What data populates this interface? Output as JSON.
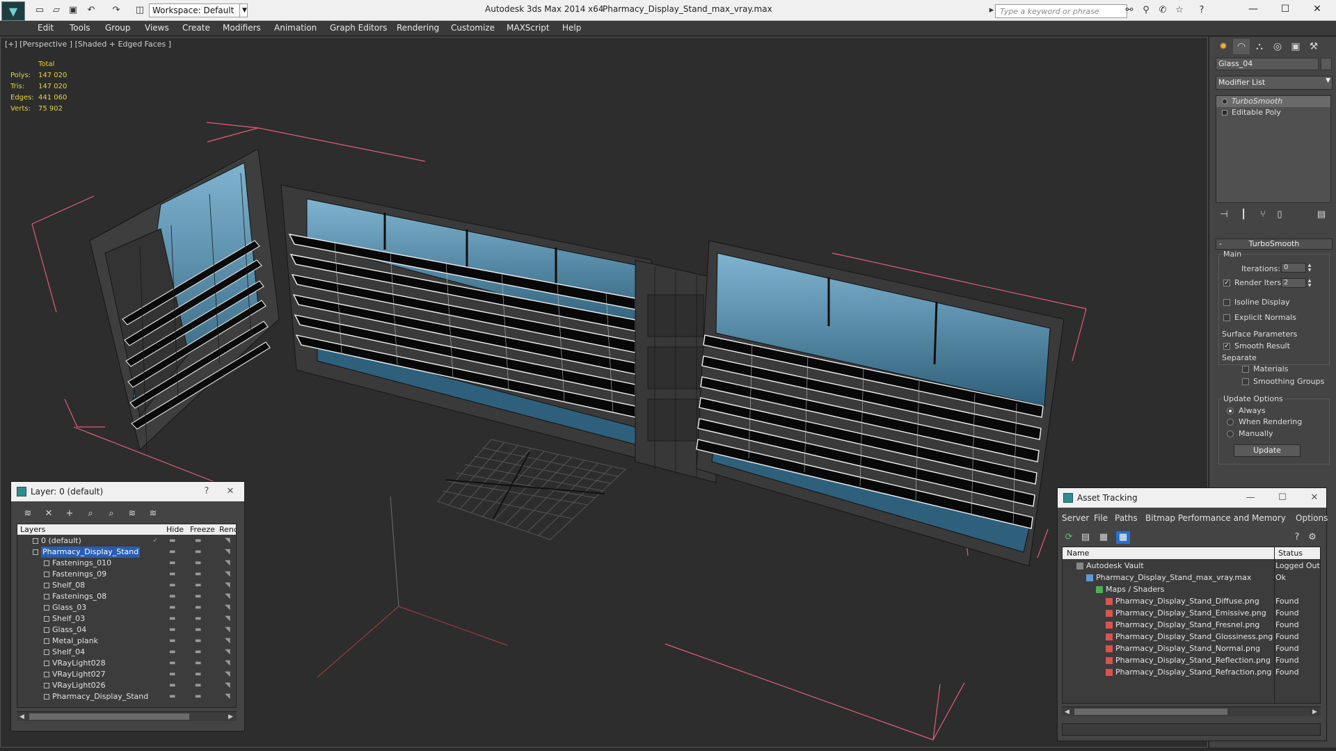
{
  "titlebar": {
    "workspace": "Workspace: Default",
    "app_title": "Autodesk 3ds Max  2014 x64",
    "file_title": "Pharmacy_Display_Stand_max_vray.max",
    "search_placeholder": "Type a keyword or phrase"
  },
  "menu": [
    "Edit",
    "Tools",
    "Group",
    "Views",
    "Create",
    "Modifiers",
    "Animation",
    "Graph Editors",
    "Rendering",
    "Customize",
    "MAXScript",
    "Help"
  ],
  "viewport": {
    "label": "[+] [Perspective ] [Shaded + Edged Faces ]",
    "stats": {
      "header": "Total",
      "rows": [
        {
          "label": "Polys:",
          "value": "147 020"
        },
        {
          "label": "Tris:",
          "value": "147 020"
        },
        {
          "label": "Edges:",
          "value": "441 060"
        },
        {
          "label": "Verts:",
          "value": "75 902"
        }
      ]
    }
  },
  "command_panel": {
    "object_name": "Glass_04",
    "modifier_list": "Modifier List",
    "stack": [
      "TurboSmooth",
      "Editable Poly"
    ],
    "rollout_title": "TurboSmooth",
    "main_label": "Main",
    "iterations_label": "Iterations:",
    "iterations_value": "0",
    "render_iters_label": "Render Iters:",
    "render_iters_value": "2",
    "isoline_display": "Isoline Display",
    "explicit_normals": "Explicit Normals",
    "surface_params": "Surface Parameters",
    "smooth_result": "Smooth Result",
    "separate": "Separate",
    "materials": "Materials",
    "smoothing_groups": "Smoothing Groups",
    "update_options": "Update Options",
    "always": "Always",
    "when_rendering": "When Rendering",
    "manually": "Manually",
    "update_button": "Update"
  },
  "layer_manager": {
    "title": "Layer: 0 (default)",
    "help": "?",
    "columns": [
      "Layers",
      "Hide",
      "Freeze",
      "Renc"
    ],
    "rows": [
      {
        "name": "0 (default)",
        "indent": 0,
        "type": "layer",
        "current": true
      },
      {
        "name": "Pharmacy_Display_Stand",
        "indent": 0,
        "type": "layer",
        "selected": true
      },
      {
        "name": "Fastenings_010",
        "indent": 1,
        "type": "object"
      },
      {
        "name": "Fastenings_09",
        "indent": 1,
        "type": "object"
      },
      {
        "name": "Shelf_08",
        "indent": 1,
        "type": "object"
      },
      {
        "name": "Fastenings_08",
        "indent": 1,
        "type": "object"
      },
      {
        "name": "Glass_03",
        "indent": 1,
        "type": "object"
      },
      {
        "name": "Shelf_03",
        "indent": 1,
        "type": "object"
      },
      {
        "name": "Glass_04",
        "indent": 1,
        "type": "object"
      },
      {
        "name": "Metal_plank",
        "indent": 1,
        "type": "object"
      },
      {
        "name": "Shelf_04",
        "indent": 1,
        "type": "object"
      },
      {
        "name": "VRayLight028",
        "indent": 1,
        "type": "object"
      },
      {
        "name": "VRayLight027",
        "indent": 1,
        "type": "object"
      },
      {
        "name": "VRayLight026",
        "indent": 1,
        "type": "object"
      },
      {
        "name": "Pharmacy_Display_Stand",
        "indent": 1,
        "type": "object"
      }
    ]
  },
  "asset_tracking": {
    "title": "Asset Tracking",
    "menu": [
      "Server",
      "File",
      "Paths",
      "Bitmap Performance and Memory",
      "Options"
    ],
    "columns": [
      "Name",
      "Status"
    ],
    "rows": [
      {
        "name": "Autodesk Vault",
        "status": "Logged Out",
        "indent": 0,
        "icon": "vault-icon"
      },
      {
        "name": "Pharmacy_Display_Stand_max_vray.max",
        "status": "Ok",
        "indent": 1,
        "icon": "max-file-icon"
      },
      {
        "name": "Maps / Shaders",
        "status": "",
        "indent": 2,
        "icon": "folder-icon"
      },
      {
        "name": "Pharmacy_Display_Stand_Diffuse.png",
        "status": "Found",
        "indent": 3,
        "icon": "png-icon"
      },
      {
        "name": "Pharmacy_Display_Stand_Emissive.png",
        "status": "Found",
        "indent": 3,
        "icon": "png-icon"
      },
      {
        "name": "Pharmacy_Display_Stand_Fresnel.png",
        "status": "Found",
        "indent": 3,
        "icon": "png-icon"
      },
      {
        "name": "Pharmacy_Display_Stand_Glossiness.png",
        "status": "Found",
        "indent": 3,
        "icon": "png-icon"
      },
      {
        "name": "Pharmacy_Display_Stand_Normal.png",
        "status": "Found",
        "indent": 3,
        "icon": "png-icon"
      },
      {
        "name": "Pharmacy_Display_Stand_Reflection.png",
        "status": "Found",
        "indent": 3,
        "icon": "png-icon"
      },
      {
        "name": "Pharmacy_Display_Stand_Refraction.png",
        "status": "Found",
        "indent": 3,
        "icon": "png-icon"
      }
    ]
  },
  "colors": {
    "viewport_bg": "#2d2d2d",
    "stats_text": "#e6d43a",
    "bbox_pink": "#e0607a",
    "glass_blue": "#4f8fb3",
    "selection_blue": "#2a5db0"
  }
}
